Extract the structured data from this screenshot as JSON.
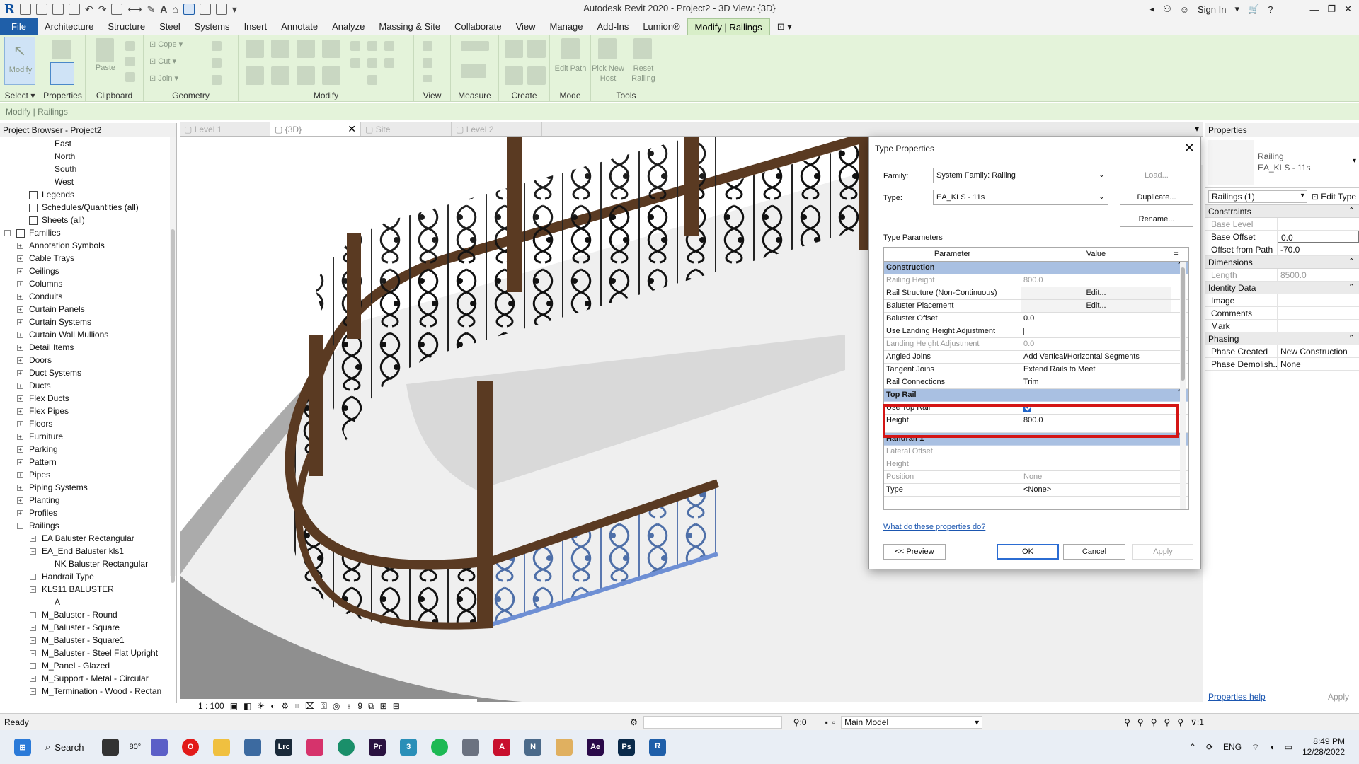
{
  "app": {
    "title": "Autodesk Revit 2020 - Project2 - 3D View: {3D}",
    "sign_in": "Sign In",
    "logo": "R"
  },
  "menu": {
    "tabs": [
      "File",
      "Architecture",
      "Structure",
      "Steel",
      "Systems",
      "Insert",
      "Annotate",
      "Analyze",
      "Massing & Site",
      "Collaborate",
      "View",
      "Manage",
      "Add-Ins",
      "Lumion®",
      "Modify | Railings"
    ]
  },
  "ribbon": {
    "select_label": "Select",
    "properties_label": "Properties",
    "clipboard_label": "Clipboard",
    "geometry_label": "Geometry",
    "modify_label": "Modify",
    "view_label": "View",
    "measure_label": "Measure",
    "create_label": "Create",
    "mode_label": "Mode",
    "tools_label": "Tools",
    "modify_btn": "Modify",
    "paste_btn": "Paste",
    "cope_btn": "Cope",
    "cut_btn": "Cut",
    "join_btn": "Join",
    "edit_path_btn": "Edit Path",
    "pick_new_host_btn": "Pick New Host",
    "reset_railing_btn": "Reset Railing",
    "context": "Modify | Railings"
  },
  "browser": {
    "title": "Project Browser - Project2",
    "items": [
      {
        "label": "East",
        "indent": 3,
        "exp": "none"
      },
      {
        "label": "North",
        "indent": 3,
        "exp": "none"
      },
      {
        "label": "South",
        "indent": 3,
        "exp": "none"
      },
      {
        "label": "West",
        "indent": 3,
        "exp": "none"
      },
      {
        "label": "Legends",
        "indent": 1,
        "exp": "none",
        "icon": true
      },
      {
        "label": "Schedules/Quantities (all)",
        "indent": 1,
        "exp": "none",
        "icon": true
      },
      {
        "label": "Sheets (all)",
        "indent": 1,
        "exp": "none",
        "icon": true
      },
      {
        "label": "Families",
        "indent": 0,
        "exp": "-",
        "icon": true
      },
      {
        "label": "Annotation Symbols",
        "indent": 1,
        "exp": "+"
      },
      {
        "label": "Cable Trays",
        "indent": 1,
        "exp": "+"
      },
      {
        "label": "Ceilings",
        "indent": 1,
        "exp": "+"
      },
      {
        "label": "Columns",
        "indent": 1,
        "exp": "+"
      },
      {
        "label": "Conduits",
        "indent": 1,
        "exp": "+"
      },
      {
        "label": "Curtain Panels",
        "indent": 1,
        "exp": "+"
      },
      {
        "label": "Curtain Systems",
        "indent": 1,
        "exp": "+"
      },
      {
        "label": "Curtain Wall Mullions",
        "indent": 1,
        "exp": "+"
      },
      {
        "label": "Detail Items",
        "indent": 1,
        "exp": "+"
      },
      {
        "label": "Doors",
        "indent": 1,
        "exp": "+"
      },
      {
        "label": "Duct Systems",
        "indent": 1,
        "exp": "+"
      },
      {
        "label": "Ducts",
        "indent": 1,
        "exp": "+"
      },
      {
        "label": "Flex Ducts",
        "indent": 1,
        "exp": "+"
      },
      {
        "label": "Flex Pipes",
        "indent": 1,
        "exp": "+"
      },
      {
        "label": "Floors",
        "indent": 1,
        "exp": "+"
      },
      {
        "label": "Furniture",
        "indent": 1,
        "exp": "+"
      },
      {
        "label": "Parking",
        "indent": 1,
        "exp": "+"
      },
      {
        "label": "Pattern",
        "indent": 1,
        "exp": "+"
      },
      {
        "label": "Pipes",
        "indent": 1,
        "exp": "+"
      },
      {
        "label": "Piping Systems",
        "indent": 1,
        "exp": "+"
      },
      {
        "label": "Planting",
        "indent": 1,
        "exp": "+"
      },
      {
        "label": "Profiles",
        "indent": 1,
        "exp": "+"
      },
      {
        "label": "Railings",
        "indent": 1,
        "exp": "-"
      },
      {
        "label": "EA Baluster Rectangular",
        "indent": 2,
        "exp": "+"
      },
      {
        "label": "EA_End Baluster kls1",
        "indent": 2,
        "exp": "-"
      },
      {
        "label": "NK Baluster Rectangular",
        "indent": 3,
        "exp": "none"
      },
      {
        "label": "Handrail Type",
        "indent": 2,
        "exp": "+"
      },
      {
        "label": "KLS11 BALUSTER",
        "indent": 2,
        "exp": "-"
      },
      {
        "label": "A",
        "indent": 3,
        "exp": "none"
      },
      {
        "label": "M_Baluster - Round",
        "indent": 2,
        "exp": "+"
      },
      {
        "label": "M_Baluster - Square",
        "indent": 2,
        "exp": "+"
      },
      {
        "label": "M_Baluster - Square1",
        "indent": 2,
        "exp": "+"
      },
      {
        "label": "M_Baluster - Steel Flat Upright",
        "indent": 2,
        "exp": "+"
      },
      {
        "label": "M_Panel - Glazed",
        "indent": 2,
        "exp": "+"
      },
      {
        "label": "M_Support - Metal - Circular",
        "indent": 2,
        "exp": "+"
      },
      {
        "label": "M_Termination - Wood - Rectan",
        "indent": 2,
        "exp": "+"
      }
    ]
  },
  "view_tabs": [
    {
      "label": "Level 1"
    },
    {
      "label": "{3D}",
      "active": true
    },
    {
      "label": "Site"
    },
    {
      "label": "Level 2"
    }
  ],
  "view_control": {
    "scale": "1 : 100",
    "detail_num": "9"
  },
  "status": {
    "left": "Ready",
    "sel_count": ":0",
    "model": "Main Model"
  },
  "properties": {
    "title": "Properties",
    "family_line1": "Railing",
    "family_line2": "EA_KLS - 11s",
    "selector": "Railings (1)",
    "edit_type": "Edit Type",
    "sections": [
      {
        "name": "Constraints",
        "rows": [
          {
            "k": "Base Level",
            "v": "",
            "dim": true
          },
          {
            "k": "Base Offset",
            "v": "0.0"
          },
          {
            "k": "Offset from Path",
            "v": "-70.0"
          }
        ]
      },
      {
        "name": "Dimensions",
        "rows": [
          {
            "k": "Length",
            "v": "8500.0",
            "dim": true
          }
        ]
      },
      {
        "name": "Identity Data",
        "rows": [
          {
            "k": "Image",
            "v": ""
          },
          {
            "k": "Comments",
            "v": ""
          },
          {
            "k": "Mark",
            "v": ""
          }
        ]
      },
      {
        "name": "Phasing",
        "rows": [
          {
            "k": "Phase Created",
            "v": "New Construction"
          },
          {
            "k": "Phase Demolish...",
            "v": "None"
          }
        ]
      }
    ],
    "help": "Properties help",
    "apply": "Apply"
  },
  "dialog": {
    "title": "Type Properties",
    "family_label": "Family:",
    "family_value": "System Family: Railing",
    "type_label": "Type:",
    "type_value": "EA_KLS - 11s",
    "load": "Load...",
    "duplicate": "Duplicate...",
    "rename": "Rename...",
    "type_params": "Type Parameters",
    "col_param": "Parameter",
    "col_value": "Value",
    "col_eq": "=",
    "help_link": "What do these properties do?",
    "preview": "<< Preview",
    "ok": "OK",
    "cancel": "Cancel",
    "apply": "Apply",
    "rows": [
      {
        "sec": "Construction"
      },
      {
        "p": "Railing Height",
        "v": "800.0",
        "dim": true
      },
      {
        "p": "Rail Structure (Non-Continuous)",
        "v": "Edit...",
        "btn": true
      },
      {
        "p": "Baluster Placement",
        "v": "Edit...",
        "btn": true
      },
      {
        "p": "Baluster Offset",
        "v": "0.0"
      },
      {
        "p": "Use Landing Height Adjustment",
        "v": "",
        "check": "off"
      },
      {
        "p": "Landing Height Adjustment",
        "v": "0.0",
        "dim": true
      },
      {
        "p": "Angled Joins",
        "v": "Add Vertical/Horizontal Segments"
      },
      {
        "p": "Tangent Joins",
        "v": "Extend Rails to Meet"
      },
      {
        "p": "Rail Connections",
        "v": "Trim"
      },
      {
        "sec": "Top Rail"
      },
      {
        "p": "Use Top Rail",
        "v": "",
        "check": "on"
      },
      {
        "p": "Height",
        "v": "800.0"
      },
      {
        "p": "",
        "v": "",
        "partial": true
      },
      {
        "sec": "Handrail 1"
      },
      {
        "p": "Lateral Offset",
        "v": "",
        "dim": true
      },
      {
        "p": "Height",
        "v": "",
        "dim": true
      },
      {
        "p": "Position",
        "v": "None",
        "dim": true
      },
      {
        "p": "Type",
        "v": "<None>"
      }
    ]
  },
  "taskbar": {
    "search": "Search",
    "temp": "80°",
    "lang": "ENG",
    "time": "8:49 PM",
    "date": "12/28/2022"
  },
  "colors": {
    "accent": "#1f5fa9",
    "ribbon_bg": "#e4f3da",
    "railing_wood": "#5a3a22",
    "highlight": "#d41515",
    "grid_section": "#a9c0e2"
  }
}
